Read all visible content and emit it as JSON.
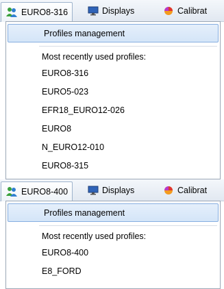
{
  "panels": [
    {
      "profile_button_label": "EURO8-316",
      "displays_label": "Displays",
      "calibration_label": "Calibrat",
      "menu": {
        "profiles_management": "Profiles management",
        "recent_heading": "Most recently used profiles:",
        "recent": [
          "EURO8-316",
          "EURO5-023",
          "EFR18_EURO12-026",
          "EURO8",
          "N_EURO12-010",
          "EURO8-315"
        ]
      }
    },
    {
      "profile_button_label": "EURO8-400",
      "displays_label": "Displays",
      "calibration_label": "Calibrat",
      "menu": {
        "profiles_management": "Profiles management",
        "recent_heading": "Most recently used profiles:",
        "recent": [
          "EURO8-400",
          "E8_FORD"
        ]
      }
    }
  ],
  "icons": {
    "profile": "people-icon",
    "displays": "monitor-icon",
    "calibration": "calibration-icon"
  },
  "colors": {
    "highlight": "#d4e5f8",
    "highlight_border": "#86aee0"
  }
}
